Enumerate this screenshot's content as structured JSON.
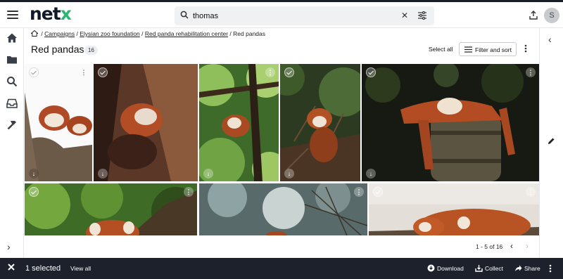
{
  "app": {
    "logo_main": "net",
    "logo_accent": "x"
  },
  "search": {
    "value": "thomas",
    "placeholder": "Search"
  },
  "user": {
    "avatar_initial": "S"
  },
  "breadcrumb": {
    "items": [
      "Campaigns",
      "Elysian zoo foundation",
      "Red panda rehabilitation center"
    ],
    "current": "Red pandas",
    "separator": "/"
  },
  "folder": {
    "title": "Red pandas",
    "count": "16"
  },
  "toolbar": {
    "select_all": "Select all",
    "filter_sort": "Filter and sort"
  },
  "pagination": {
    "label": "1 - 5 of 16"
  },
  "selection": {
    "count_label": "1 selected",
    "view_all": "View all",
    "actions": {
      "download": "Download",
      "collect": "Collect",
      "share": "Share"
    }
  },
  "icons": {
    "nav": [
      "home-icon",
      "folder-icon",
      "search-icon",
      "inbox-icon",
      "hammer-icon"
    ],
    "right_rail": [
      "chevron-left-icon",
      "pencil-icon"
    ]
  },
  "colors": {
    "accent": "#2bb673",
    "bottom_bar": "#1c212b"
  }
}
